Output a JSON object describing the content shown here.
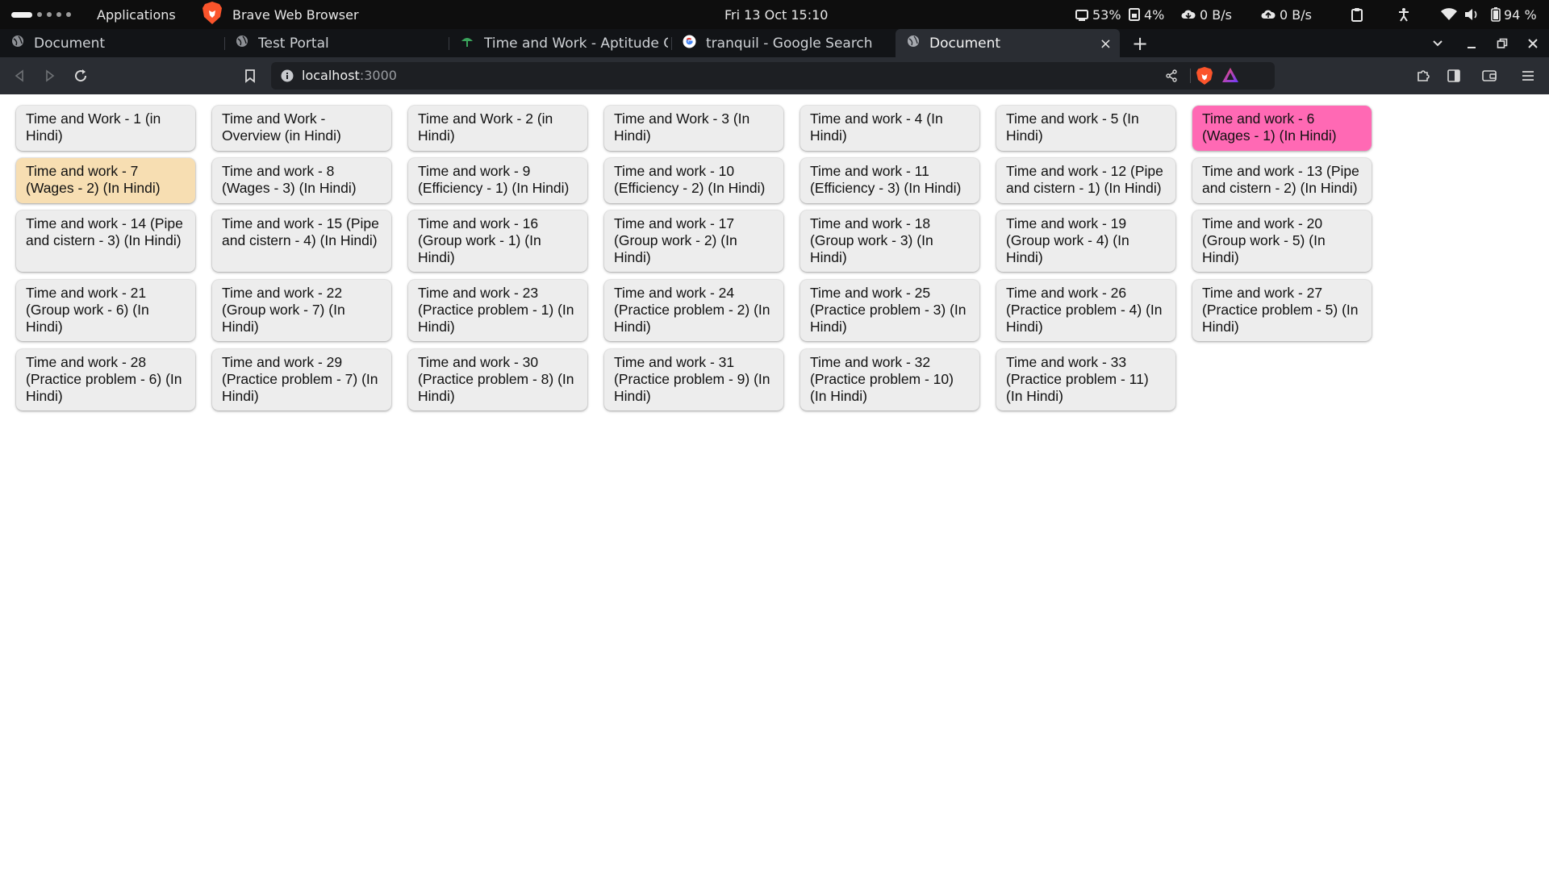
{
  "system_bar": {
    "applications_label": "Applications",
    "browser_app_label": "Brave Web Browser",
    "clock": "Fri 13 Oct  15:10",
    "cpu": "53%",
    "memory": "4%",
    "download": "0 B/s",
    "upload": "0 B/s",
    "battery": "94 %"
  },
  "tabs": [
    {
      "title": "Document",
      "icon": "globe-icon",
      "active": false
    },
    {
      "title": "Test Portal",
      "icon": "globe-icon",
      "active": false
    },
    {
      "title": "Time and Work - Aptitude Que",
      "icon": "site-favicon-icon",
      "active": false
    },
    {
      "title": "tranquil - Google Search",
      "icon": "google-icon",
      "active": false
    },
    {
      "title": "Document",
      "icon": "globe-icon",
      "active": true
    }
  ],
  "address_bar": {
    "host": "localhost",
    "port": ":3000"
  },
  "colors": {
    "highlight_pink": "#ff69b4",
    "highlight_peach": "#f7deb2",
    "card_default": "#ededed"
  },
  "cards": [
    {
      "label": "Time and Work - 1 (in Hindi)",
      "state": "default"
    },
    {
      "label": "Time and Work - Overview (in Hindi)",
      "state": "default"
    },
    {
      "label": "Time and Work - 2 (in Hindi)",
      "state": "default"
    },
    {
      "label": "Time and Work - 3 (In Hindi)",
      "state": "default"
    },
    {
      "label": "Time and work - 4 (In Hindi)",
      "state": "default"
    },
    {
      "label": "Time and work - 5 (In Hindi)",
      "state": "default"
    },
    {
      "label": "Time and work - 6 (Wages - 1) (In Hindi)",
      "state": "pink"
    },
    {
      "label": "Time and work - 7 (Wages - 2) (In Hindi)",
      "state": "peach"
    },
    {
      "label": "Time and work - 8 (Wages - 3) (In Hindi)",
      "state": "default"
    },
    {
      "label": "Time and work - 9 (Efficiency - 1) (In Hindi)",
      "state": "default"
    },
    {
      "label": "Time and work - 10 (Efficiency - 2) (In Hindi)",
      "state": "default"
    },
    {
      "label": "Time and work - 11 (Efficiency - 3) (In Hindi)",
      "state": "default"
    },
    {
      "label": "Time and work - 12 (Pipe and cistern - 1) (In Hindi)",
      "state": "default"
    },
    {
      "label": "Time and work - 13 (Pipe and cistern - 2) (In Hindi)",
      "state": "default"
    },
    {
      "label": "Time and work - 14 (Pipe and cistern - 3) (In Hindi)",
      "state": "default"
    },
    {
      "label": "Time and work - 15 (Pipe and cistern - 4) (In Hindi)",
      "state": "default"
    },
    {
      "label": "Time and work - 16 (Group work - 1) (In Hindi)",
      "state": "default"
    },
    {
      "label": "Time and work - 17 (Group work - 2) (In Hindi)",
      "state": "default"
    },
    {
      "label": "Time and work - 18 (Group work - 3) (In Hindi)",
      "state": "default"
    },
    {
      "label": "Time and work - 19 (Group work - 4) (In Hindi)",
      "state": "default"
    },
    {
      "label": "Time and work - 20 (Group work - 5) (In Hindi)",
      "state": "default"
    },
    {
      "label": "Time and work - 21 (Group work - 6) (In Hindi)",
      "state": "default"
    },
    {
      "label": "Time and work - 22 (Group work - 7) (In Hindi)",
      "state": "default"
    },
    {
      "label": "Time and work - 23 (Practice problem - 1) (In Hindi)",
      "state": "default"
    },
    {
      "label": "Time and work - 24 (Practice problem - 2) (In Hindi)",
      "state": "default"
    },
    {
      "label": "Time and work - 25 (Practice problem - 3) (In Hindi)",
      "state": "default"
    },
    {
      "label": "Time and work - 26 (Practice problem - 4) (In Hindi)",
      "state": "default"
    },
    {
      "label": "Time and work - 27 (Practice problem - 5) (In Hindi)",
      "state": "default"
    },
    {
      "label": "Time and work - 28 (Practice problem - 6) (In Hindi)",
      "state": "default"
    },
    {
      "label": "Time and work - 29 (Practice problem - 7) (In Hindi)",
      "state": "default"
    },
    {
      "label": "Time and work - 30 (Practice problem - 8) (In Hindi)",
      "state": "default"
    },
    {
      "label": "Time and work - 31 (Practice problem - 9) (In Hindi)",
      "state": "default"
    },
    {
      "label": "Time and work - 32 (Practice problem - 10) (In Hindi)",
      "state": "default"
    },
    {
      "label": "Time and work - 33 (Practice problem - 11) (In Hindi)",
      "state": "default"
    }
  ]
}
